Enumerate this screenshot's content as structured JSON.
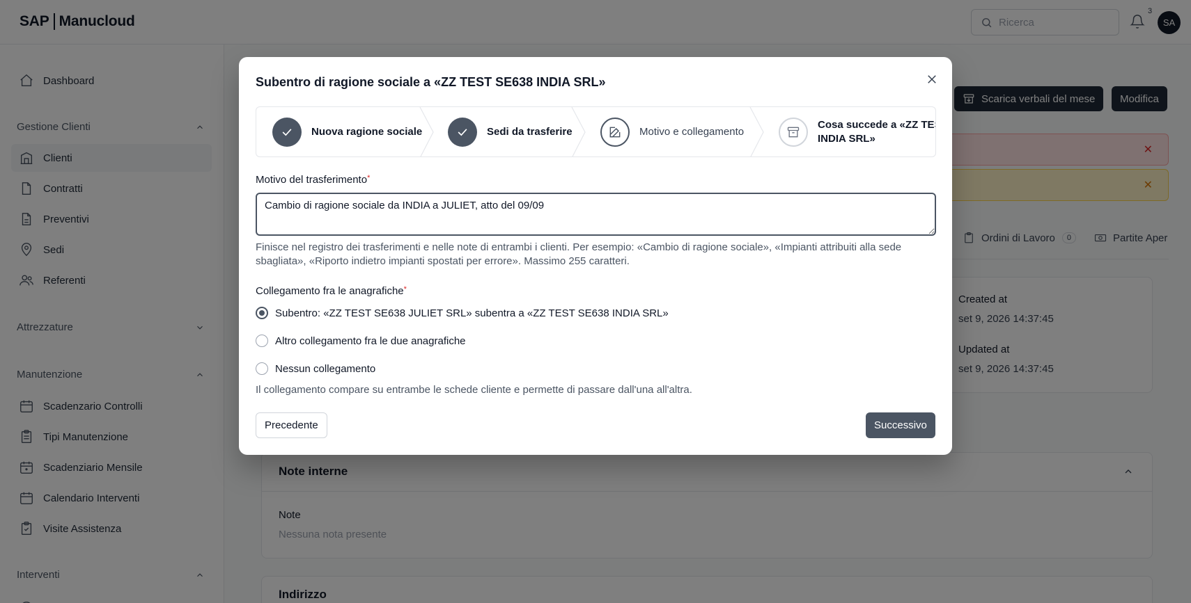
{
  "header": {
    "brand_left": "SAP",
    "brand_right": "Manucloud",
    "search_placeholder": "Ricerca",
    "notifications_count": "3",
    "avatar_initials": "SA"
  },
  "sidebar": {
    "dashboard": "Dashboard",
    "groups": {
      "clienti": "Gestione Clienti",
      "attrezzature": "Attrezzature",
      "manutenzione": "Manutenzione",
      "interventi": "Interventi"
    },
    "clienti_items": [
      "Clienti",
      "Contratti",
      "Preventivi",
      "Sedi",
      "Referenti"
    ],
    "manutenzione_items": [
      "Scadenzario Controlli",
      "Tipi Manutenzione",
      "Scadenziario Mensile",
      "Calendario Interventi",
      "Visite Assistenza"
    ]
  },
  "background": {
    "download_button": "Scarica verbali del mese",
    "edit_button": "Modifica",
    "tabs": [
      {
        "label": "Ordini di Lavoro",
        "count": "0"
      },
      {
        "label": "Partite Aper"
      }
    ],
    "created_label": "Created at",
    "created_value": "set 9, 2026 14:37:45",
    "updated_label": "Updated at",
    "updated_value": "set 9, 2026 14:37:45",
    "note_section_title": "Note interne",
    "note_label": "Note",
    "note_empty": "Nessuna nota presente",
    "address_section_title": "Indirizzo"
  },
  "modal": {
    "title": "Subentro di ragione sociale a «ZZ TEST SE638 INDIA SRL»",
    "steps": [
      {
        "label": "Nuova ragione sociale",
        "state": "done"
      },
      {
        "label": "Sedi da trasferire",
        "state": "done"
      },
      {
        "label": "Motivo e collegamento",
        "state": "current"
      },
      {
        "label_line1": "Cosa succede a «ZZ TEST",
        "label_line2": "INDIA SRL»",
        "state": "future"
      }
    ],
    "reason_label": "Motivo del trasferimento",
    "reason_value": "Cambio di ragione sociale da INDIA a JULIET, atto del 09/09",
    "reason_help": "Finisce nel registro dei trasferimenti e nelle note di entrambi i clienti. Per esempio: «Cambio di ragione sociale», «Impianti attribuiti alla sede sbagliata», «Riporto indietro impianti spostati per errore». Massimo 255 caratteri.",
    "link_label": "Collegamento fra le anagrafiche",
    "link_options": [
      {
        "label": "Subentro: «ZZ TEST SE638 JULIET SRL» subentra a «ZZ TEST SE638 INDIA SRL»",
        "selected": true
      },
      {
        "label": "Altro collegamento fra le due anagrafiche",
        "selected": false
      },
      {
        "label": "Nessun collegamento",
        "selected": false
      }
    ],
    "link_help": "Il collegamento compare su entrambe le schede cliente e permette di passare dall'una all'altra.",
    "prev_button": "Precedente",
    "next_button": "Successivo"
  }
}
